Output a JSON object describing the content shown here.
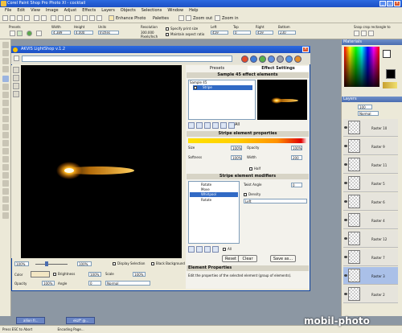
{
  "app": {
    "title": "Corel Paint Shop Pro Photo XI - cocktail"
  },
  "menu": [
    "File",
    "Edit",
    "View",
    "Image",
    "Adjust",
    "Effects",
    "Layers",
    "Objects",
    "Selections",
    "Window",
    "Help"
  ],
  "toolbar": {
    "enhance_photo": "Enhance Photo",
    "palettes": "Palettes",
    "zoom_out": "Zoom out",
    "zoom_in": "Zoom in"
  },
  "options": {
    "presets_label": "Presets",
    "width_label": "Width",
    "width_value": "4.389",
    "height_label": "Height",
    "height_value": "4.000",
    "units_label": "Units",
    "units_value": "Inches",
    "resolution_label": "Resolution",
    "resolution_value": "300.000",
    "resolution_unit": "Pixels/Inch",
    "specify_print_size": "Specify print size",
    "maintain_aspect": "Maintain aspect ratio",
    "left_label": "Left",
    "left_value": "459",
    "top_label": "Top",
    "top_value": "0",
    "right_label": "Right",
    "right_value": "459",
    "bottom_label": "Bottom",
    "bottom_value": "230",
    "snap_label": "Snap crop rectangle to"
  },
  "plugin": {
    "title": "AKVIS LightShop v.1.2",
    "tab_presets": "Presets",
    "tab_effect": "Effect Settings",
    "sample_header": "Sample 45 effect elements",
    "tree_root": "Sample 45",
    "tree_child": "Stripe",
    "props_header": "Stripe element properties",
    "size_label": "Size",
    "size_value": "100%",
    "opacity_label": "Opacity",
    "opacity_value": "100%",
    "softness_label": "Softness",
    "softness_value": "100%",
    "width_label": "Width",
    "width_value": "200",
    "half_label": "Half",
    "modifiers_header": "Stripe element modifiers",
    "modifiers": [
      "Rotate",
      "Move",
      "Whirlpool",
      "Rotate"
    ],
    "twist_label": "Twist Angle",
    "twist_value": "0",
    "density_label": "Density",
    "direction_value": "Left",
    "all_label": "All",
    "reset_btn": "Reset",
    "clear_btn": "Clear",
    "save_btn": "Save as...",
    "info_title": "Element Properties",
    "info_text": "Edit the properties of the selected element (group of elements).",
    "zoom_value": "100%",
    "zoom_value2": "100%",
    "display_selection": "Display Selection",
    "black_background": "Black Background",
    "color_label": "Color",
    "brightness_label": "Brightness",
    "brightness_value": "100%",
    "scale_label": "Scale",
    "scale_value": "100%",
    "opacity2_label": "Opacity",
    "opacity2_value": "100%",
    "angle_label": "Angle",
    "angle_value": "0",
    "blend_value": "Normal"
  },
  "right_panel": {
    "materials": "Materials",
    "layers": "Layers",
    "blend_mode": "Normal",
    "opacity": "100",
    "layers_list": [
      "Raster 10",
      "Raster 9",
      "Raster 11",
      "Raster 5",
      "Raster 6",
      "Raster 4",
      "Raster 12",
      "Raster 7",
      "Raster 3",
      "Raster 2"
    ]
  },
  "taskbar": [
    {
      "label": "allion fr..."
    },
    {
      "label": "ekzf* @..."
    }
  ],
  "status": {
    "left": "Press ESC to Abort",
    "right": "Encoding Page..."
  },
  "watermark": "mobil-photo"
}
